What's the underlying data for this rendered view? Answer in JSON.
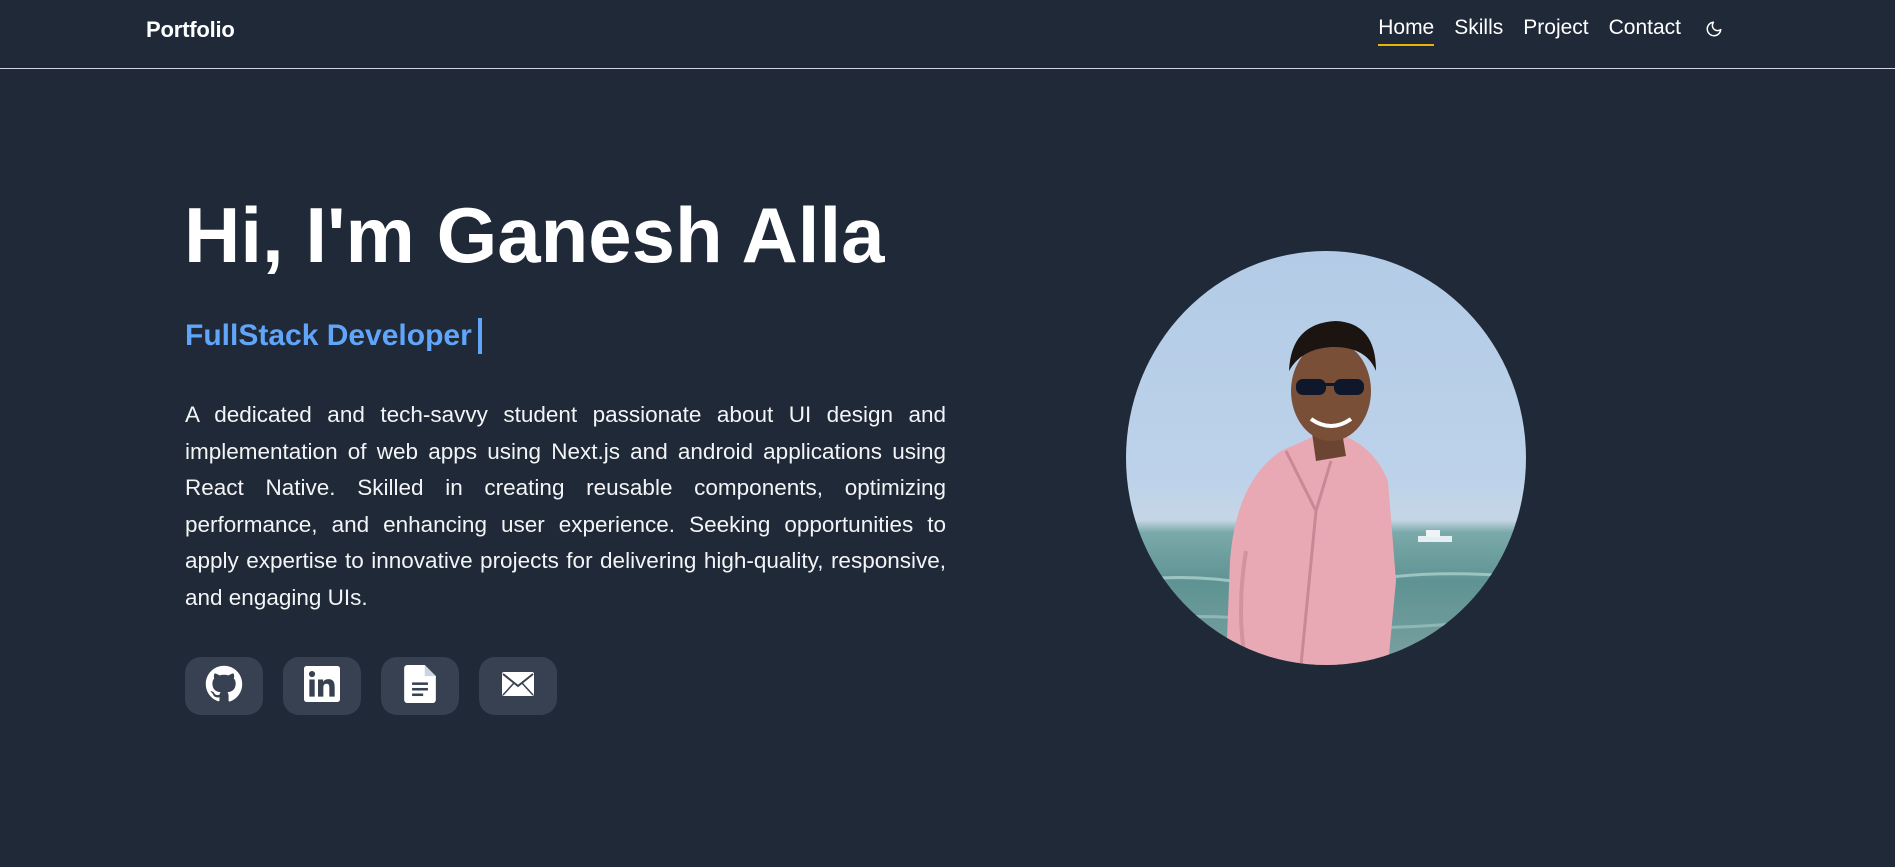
{
  "header": {
    "brand": "Portfolio",
    "nav": [
      {
        "label": "Home",
        "active": true
      },
      {
        "label": "Skills",
        "active": false
      },
      {
        "label": "Project",
        "active": false
      },
      {
        "label": "Contact",
        "active": false
      }
    ],
    "theme_toggle_icon": "moon-icon"
  },
  "hero": {
    "title": "Hi, I'm Ganesh Alla",
    "role": "FullStack Developer",
    "bio": "A dedicated and tech-savvy student passionate about UI design and implementation of web apps using Next.js and android applications using React Native. Skilled in creating reusable components, optimizing performance, and enhancing user experience. Seeking opportunities to apply expertise to innovative projects for delivering high-quality, responsive, and engaging UIs.",
    "socials": [
      {
        "icon": "github-icon"
      },
      {
        "icon": "linkedin-icon"
      },
      {
        "icon": "resume-document-icon"
      },
      {
        "icon": "mail-icon"
      }
    ]
  },
  "colors": {
    "background": "#1f2937",
    "accent": "#60a5fa",
    "active_underline": "#eab308",
    "social_button": "#374151"
  }
}
